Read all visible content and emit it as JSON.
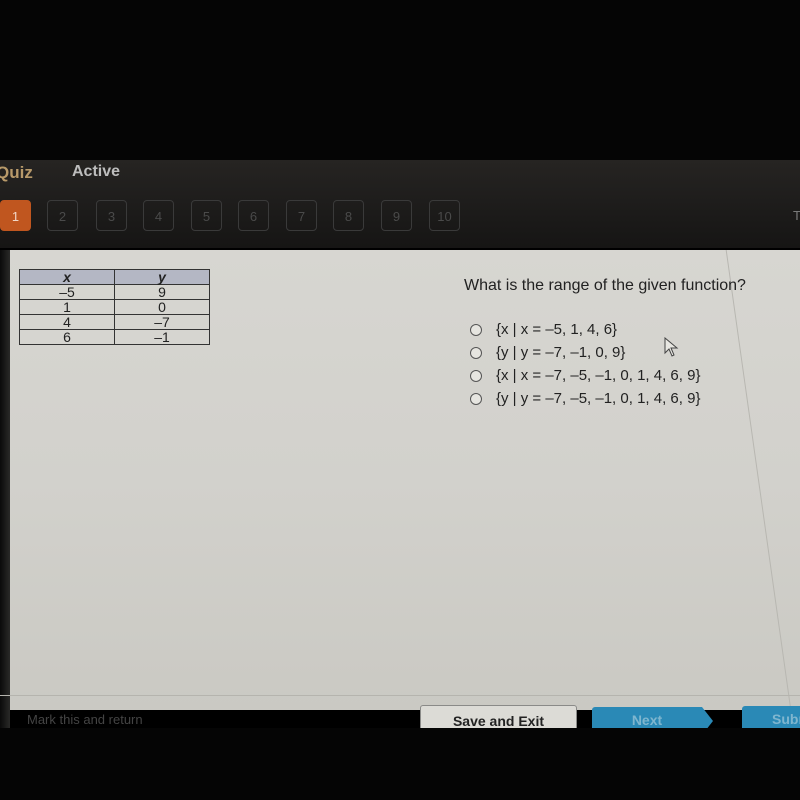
{
  "header": {
    "quiz_label": "Quiz",
    "status": "Active",
    "right_partial": "T"
  },
  "question_nav": {
    "current": 1,
    "items": [
      "1",
      "2",
      "3",
      "4",
      "5",
      "6",
      "7",
      "8",
      "9",
      "10"
    ]
  },
  "table": {
    "headers": [
      "x",
      "y"
    ],
    "rows": [
      [
        "–5",
        "9"
      ],
      [
        "1",
        "0"
      ],
      [
        "4",
        "–7"
      ],
      [
        "6",
        "–1"
      ]
    ]
  },
  "question": {
    "text": "What is the range of the given function?",
    "options": [
      "{x | x = –5, 1, 4, 6}",
      "{y | y = –7, –1, 0, 9}",
      "{x | x = –7, –5, –1, 0, 1, 4, 6, 9}",
      "{y | y = –7, –5, –1, 0, 1, 4, 6, 9}"
    ]
  },
  "footer": {
    "mark_link": "Mark this and return",
    "save_exit": "Save and Exit",
    "next": "Next",
    "submit": "Submit"
  },
  "colors": {
    "active_question": "#c0561f",
    "primary_button": "#2a89b6"
  }
}
